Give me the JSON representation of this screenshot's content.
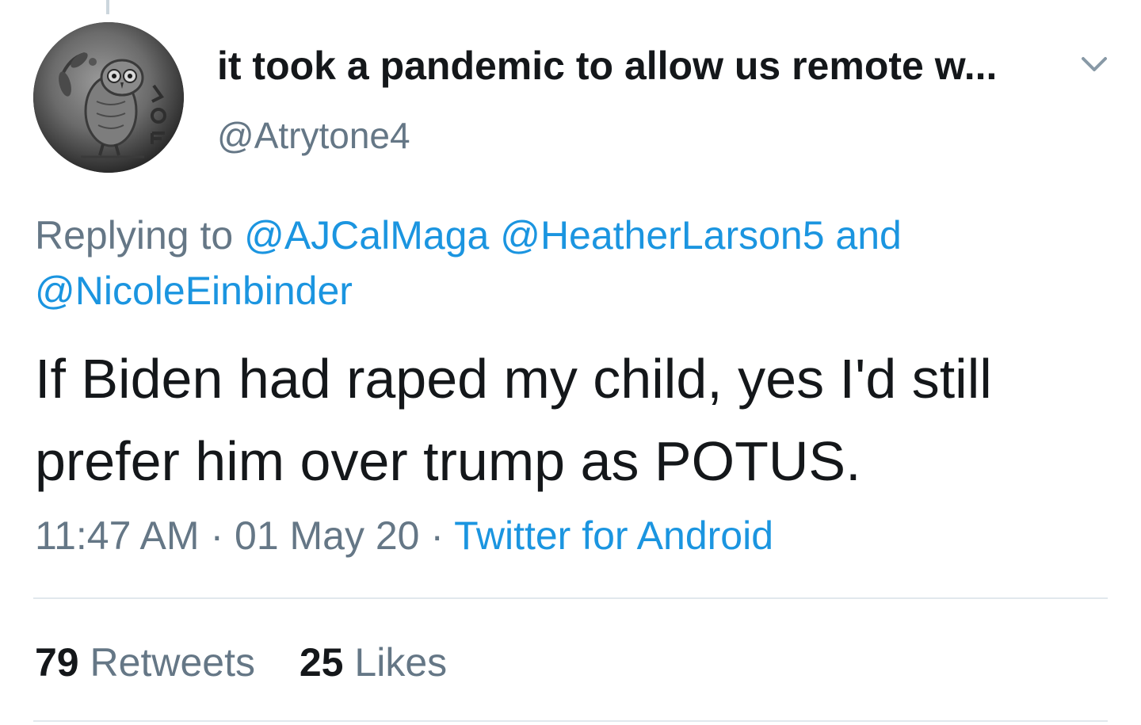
{
  "author": {
    "display_name": "it took a pandemic to allow us remote w...",
    "handle": "@Atrytone4"
  },
  "reply": {
    "prefix": "Replying to",
    "mentions": [
      "@AJCalMaga",
      "@HeatherLarson5"
    ],
    "conjunction": "and",
    "last_mention": "@NicoleEinbinder"
  },
  "tweet": {
    "text": "If Biden had raped my child, yes I'd still prefer him over trump as POTUS."
  },
  "meta": {
    "time": "11:47 AM",
    "separator": "·",
    "date": "01 May 20",
    "source": "Twitter for Android"
  },
  "stats": {
    "retweets_count": "79",
    "retweets_label": "Retweets",
    "likes_count": "25",
    "likes_label": "Likes"
  },
  "icons": {
    "avatar": "owl-coin-avatar",
    "menu": "chevron-down-icon"
  },
  "colors": {
    "text": "#14171a",
    "secondary": "#657786",
    "link": "#1b95e0",
    "divider": "#e1e8ed"
  }
}
